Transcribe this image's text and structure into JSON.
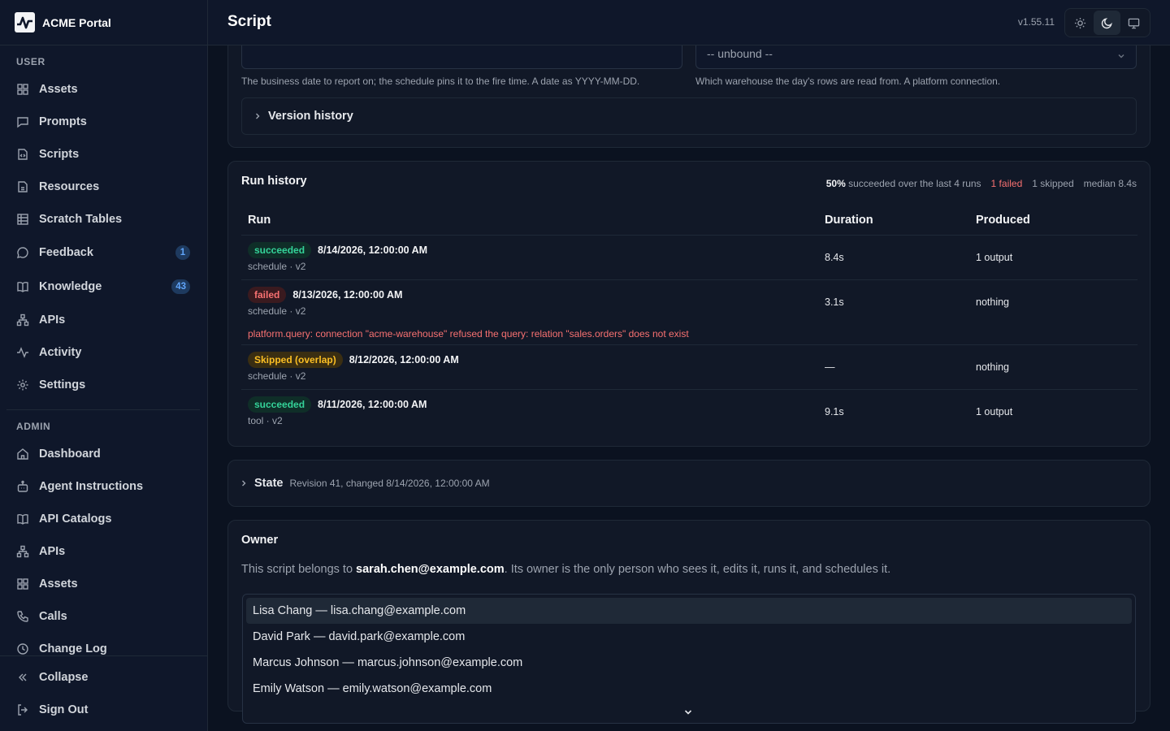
{
  "app": {
    "name": "ACME Portal",
    "version": "v1.55.11"
  },
  "header": {
    "title": "Script"
  },
  "sidebar": {
    "user_section": "USER",
    "user_items": [
      {
        "label": "Assets",
        "icon": "grid-icon"
      },
      {
        "label": "Prompts",
        "icon": "message-square-icon"
      },
      {
        "label": "Scripts",
        "icon": "code-file-icon"
      },
      {
        "label": "Resources",
        "icon": "file-icon"
      },
      {
        "label": "Scratch Tables",
        "icon": "table-icon"
      },
      {
        "label": "Feedback",
        "icon": "message-circle-icon",
        "count": "1"
      },
      {
        "label": "Knowledge",
        "icon": "book-icon",
        "count": "43"
      },
      {
        "label": "APIs",
        "icon": "network-icon"
      },
      {
        "label": "Activity",
        "icon": "activity-icon"
      },
      {
        "label": "Settings",
        "icon": "gear-icon"
      }
    ],
    "admin_section": "ADMIN",
    "admin_items": [
      {
        "label": "Dashboard",
        "icon": "home-icon"
      },
      {
        "label": "Agent Instructions",
        "icon": "bot-icon"
      },
      {
        "label": "API Catalogs",
        "icon": "book-icon"
      },
      {
        "label": "APIs",
        "icon": "network-icon"
      },
      {
        "label": "Assets",
        "icon": "grid-icon"
      },
      {
        "label": "Calls",
        "icon": "phone-icon"
      },
      {
        "label": "Change Log",
        "icon": "clock-icon"
      }
    ],
    "collapse": "Collapse",
    "sign_out": "Sign Out"
  },
  "params": {
    "warehouse_value": "-- unbound --",
    "date_help": "The business date to report on; the schedule pins it to the fire time. A date as YYYY-MM-DD.",
    "warehouse_help": "Which warehouse the day's rows are read from. A platform connection.",
    "version_history": "Version history"
  },
  "run_history": {
    "title": "Run history",
    "stats": {
      "pct": "50%",
      "summary": "succeeded over the last 4 runs",
      "failed": "1 failed",
      "skipped": "1 skipped",
      "median": "median 8.4s"
    },
    "columns": {
      "run": "Run",
      "duration": "Duration",
      "produced": "Produced"
    },
    "rows": [
      {
        "status": "succeeded",
        "time": "8/14/2026, 12:00:00 AM",
        "sub": "schedule · v2",
        "duration": "8.4s",
        "produced": "1 output"
      },
      {
        "status": "failed",
        "time": "8/13/2026, 12:00:00 AM",
        "sub": "schedule · v2",
        "duration": "3.1s",
        "produced": "nothing",
        "error": "platform.query: connection \"acme-warehouse\" refused the query: relation \"sales.orders\" does not exist"
      },
      {
        "status": "Skipped (overlap)",
        "time": "8/12/2026, 12:00:00 AM",
        "sub": "schedule · v2",
        "duration": "—",
        "produced": "nothing"
      },
      {
        "status": "succeeded",
        "time": "8/11/2026, 12:00:00 AM",
        "sub": "tool · v2",
        "duration": "9.1s",
        "produced": "1 output"
      }
    ]
  },
  "state": {
    "title": "State",
    "meta": "Revision 41, changed 8/14/2026, 12:00:00 AM"
  },
  "owner": {
    "title": "Owner",
    "text_pre": "This script belongs to ",
    "email": "sarah.chen@example.com",
    "text_post": ". Its owner is the only person who sees it, edits it, runs it, and schedules it.",
    "options": [
      "Lisa Chang — lisa.chang@example.com",
      "David Park — david.park@example.com",
      "Marcus Johnson — marcus.johnson@example.com",
      "Emily Watson — emily.watson@example.com"
    ]
  }
}
